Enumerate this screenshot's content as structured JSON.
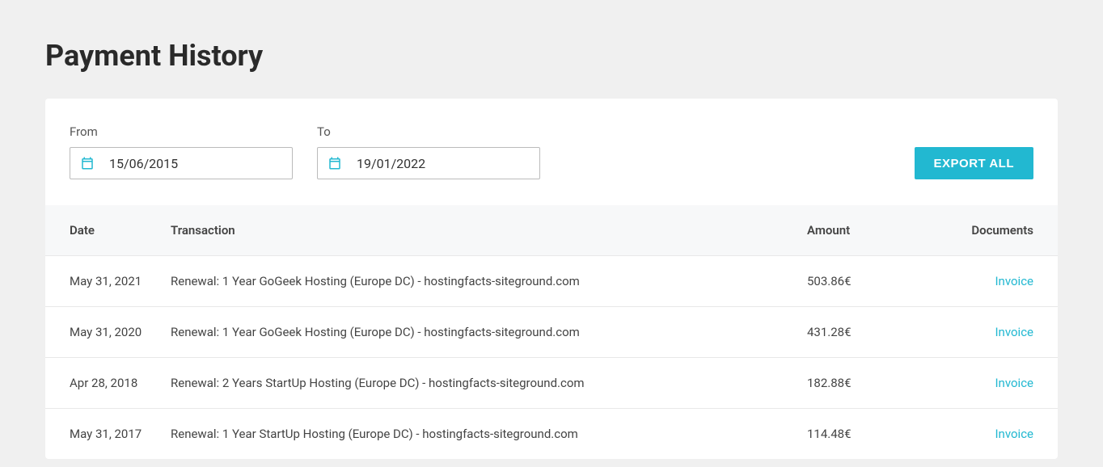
{
  "page": {
    "title": "Payment History"
  },
  "filters": {
    "from_label": "From",
    "to_label": "To",
    "from_value": "15/06/2015",
    "to_value": "19/01/2022",
    "export_label": "EXPORT ALL"
  },
  "table": {
    "headers": {
      "date": "Date",
      "transaction": "Transaction",
      "amount": "Amount",
      "documents": "Documents"
    },
    "rows": [
      {
        "date": "May 31, 2021",
        "transaction": "Renewal: 1 Year GoGeek Hosting (Europe DC) - hostingfacts-siteground.com",
        "amount": "503.86€",
        "document_label": "Invoice"
      },
      {
        "date": "May 31, 2020",
        "transaction": "Renewal: 1 Year GoGeek Hosting (Europe DC) - hostingfacts-siteground.com",
        "amount": "431.28€",
        "document_label": "Invoice"
      },
      {
        "date": "Apr 28, 2018",
        "transaction": "Renewal: 2 Years StartUp Hosting (Europe DC) - hostingfacts-siteground.com",
        "amount": "182.88€",
        "document_label": "Invoice"
      },
      {
        "date": "May 31, 2017",
        "transaction": "Renewal: 1 Year StartUp Hosting (Europe DC) - hostingfacts-siteground.com",
        "amount": "114.48€",
        "document_label": "Invoice"
      }
    ]
  }
}
